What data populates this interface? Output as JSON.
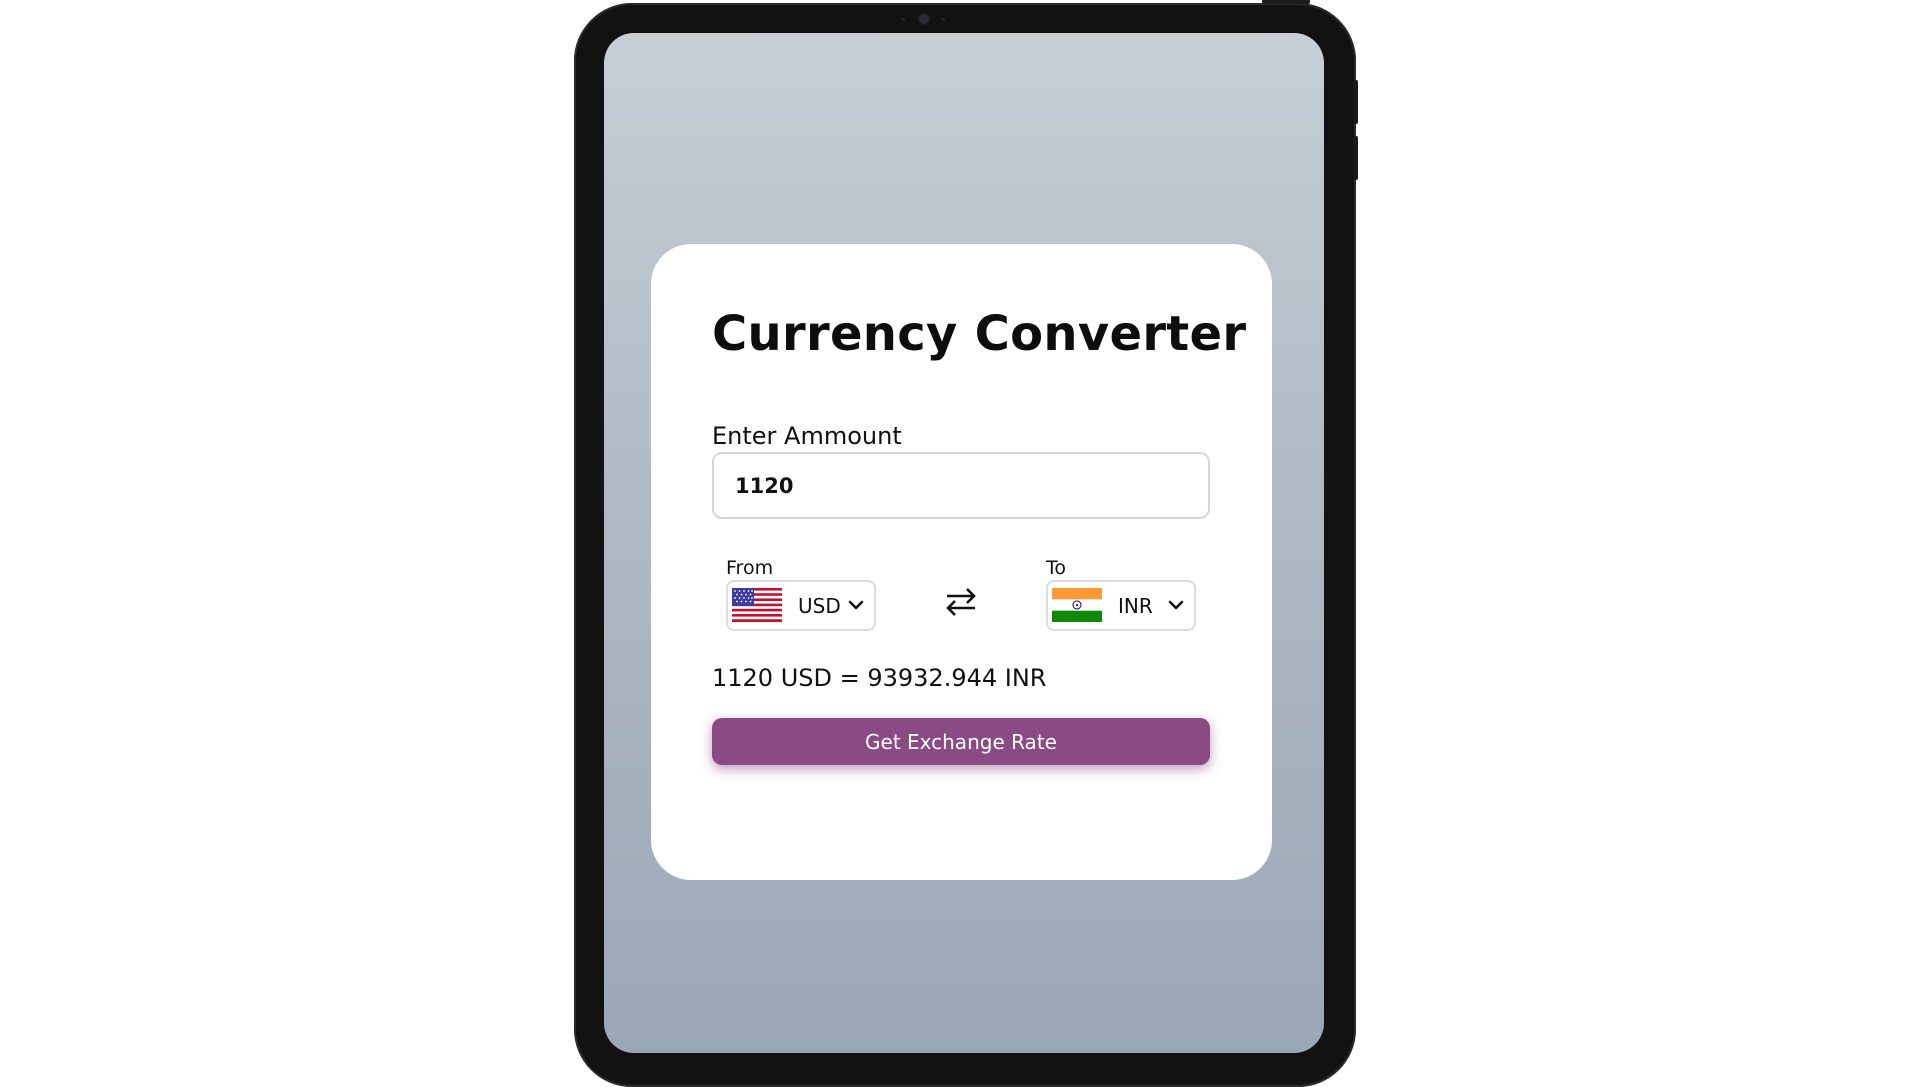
{
  "app": {
    "title": "Currency Converter"
  },
  "amount": {
    "label": "Enter Ammount",
    "value": "1120"
  },
  "from": {
    "label": "From",
    "currency": "USD",
    "flag": "us-flag-icon"
  },
  "to": {
    "label": "To",
    "currency": "INR",
    "flag": "india-flag-icon"
  },
  "swap": {
    "icon": "swap-arrows-icon"
  },
  "result": {
    "text": "1120 USD = 93932.944 INR"
  },
  "button": {
    "label": "Get Exchange Rate"
  },
  "colors": {
    "button_bg": "#8a4a83",
    "screen_top": "#c6ced6",
    "screen_bottom": "#9aa7b5",
    "device_frame": "#121212"
  }
}
